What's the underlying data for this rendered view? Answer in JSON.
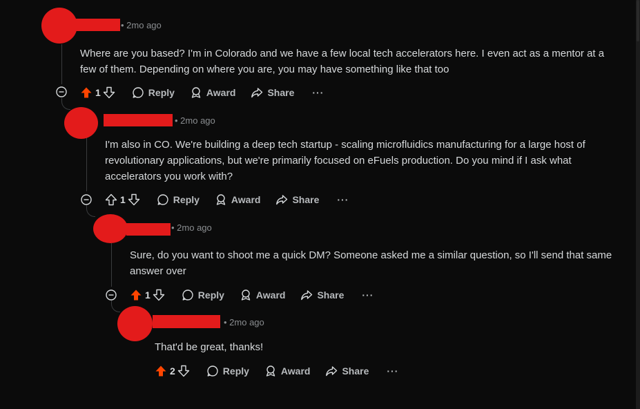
{
  "colors": {
    "background": "#0b0b0b",
    "upvote_active": "#ff4500",
    "redaction": "#e31b1b",
    "text": "#d7dadc",
    "meta": "#8a8d90"
  },
  "comments": [
    {
      "time": "• 2mo ago",
      "body": "Where are you based? I'm in Colorado and we have a few local tech accelerators here. I even act as a mentor at a few of them. Depending on where you are, you may have something like that too",
      "votes": "1",
      "upvoted": true,
      "reply": "Reply",
      "award": "Award",
      "share": "Share",
      "more": "···"
    },
    {
      "time": "• 2mo ago",
      "body": "I'm also in CO. We're building a deep tech startup - scaling microfluidics manufacturing for a large host of revolutionary applications, but we're primarily focused on eFuels production. Do you mind if I ask what accelerators you work with?",
      "votes": "1",
      "upvoted": false,
      "reply": "Reply",
      "award": "Award",
      "share": "Share",
      "more": "···"
    },
    {
      "time": "• 2mo ago",
      "body": "Sure, do you want to shoot me a quick DM? Someone asked me a similar question, so I'll send that same answer over",
      "votes": "1",
      "upvoted": true,
      "reply": "Reply",
      "award": "Award",
      "share": "Share",
      "more": "···"
    },
    {
      "time": "• 2mo ago",
      "body": "That'd be great, thanks!",
      "votes": "2",
      "upvoted": true,
      "reply": "Reply",
      "award": "Award",
      "share": "Share",
      "more": "···"
    }
  ]
}
